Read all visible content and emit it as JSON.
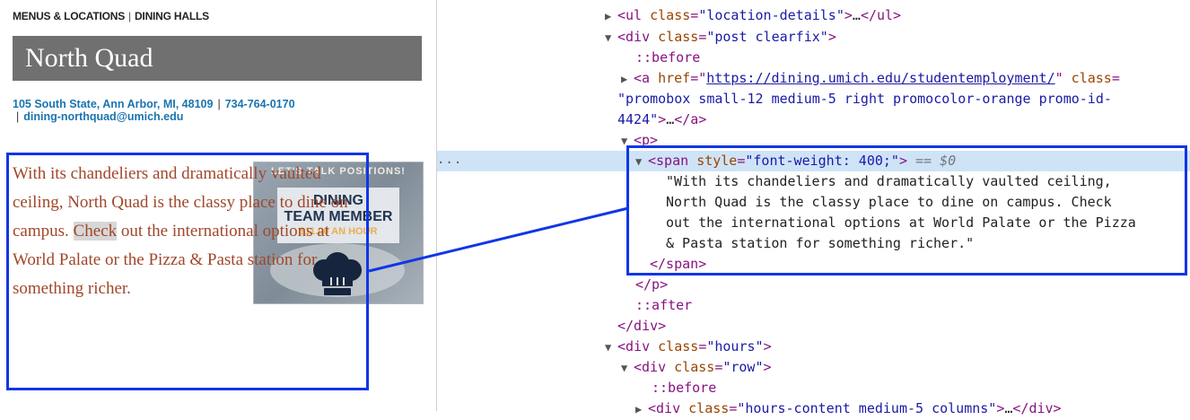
{
  "breadcrumb": {
    "menus": "MENUS & LOCATIONS",
    "dining": "DINING HALLS"
  },
  "location": {
    "title": "North Quad",
    "address": "105 South State, Ann Arbor, MI, 48109",
    "phone": "734-764-0170",
    "email": "dining-northquad@umich.edu",
    "desc_part1": "With its chandeliers and dramatically vaulted ceiling, North Quad is the classy place to dine on campus. ",
    "desc_highlight": "Check",
    "desc_part2": " out the international options at World Palate or the Pizza & Pasta station for something richer."
  },
  "promo": {
    "heading": "LET'S TALK POSITIONS!",
    "line1": "DINING",
    "line2": "TEAM MEMBER",
    "line3": "$11.00 AN HOUR"
  },
  "devtools": {
    "ellipsis": "···",
    "ul_tag": "ul",
    "ul_class_attr": "class",
    "ul_class_val": "\"location-details\"",
    "div_post_class": "\"post clearfix\"",
    "before": "::before",
    "a_href_attr": "href",
    "a_href_val": "https://dining.umich.edu/studentemployment/",
    "a_class_line1": "\"promobox small-12 medium-5 right promocolor-orange promo-id-",
    "a_class_line2": "4424\"",
    "span_style_attr": "style",
    "span_style_val": "\"font-weight: 400;\"",
    "span_eq": "== $0",
    "text_line1": "\"With its chandeliers and dramatically vaulted ceiling,",
    "text_line2": "North Quad is the classy place to dine on campus. Check",
    "text_line3": "out the international options at World Palate or the Pizza",
    "text_line4": "& Pasta station for something richer.\"",
    "after": "::after",
    "div_hours_class": "\"hours\"",
    "div_row_class": "\"row\"",
    "hours_content_partial": "\"hours-content medium-5 columns\""
  },
  "colors": {
    "title_bar": "#707070",
    "link_blue": "#1a74b0",
    "desc_text": "#a0472a",
    "annotation_blue": "#1036e6",
    "selected_row": "#cfe3f7"
  }
}
